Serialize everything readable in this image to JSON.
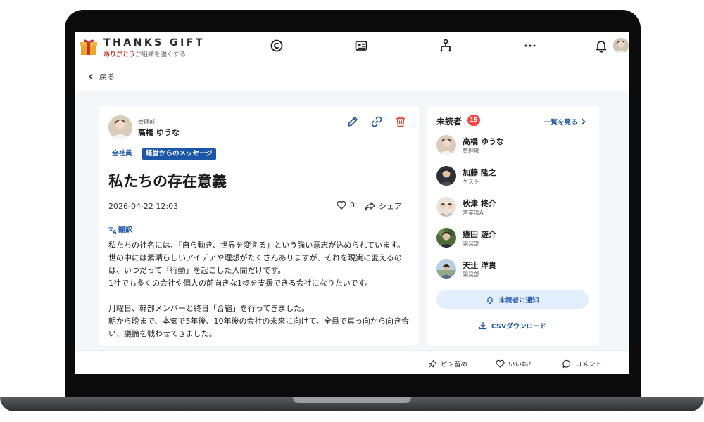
{
  "app": {
    "brand_name": "THANKS GIFT",
    "tagline_highlight": "ありがとう",
    "tagline_rest": "が組織を強くする"
  },
  "header": {
    "nav_icons": [
      "copyright-icon",
      "news-icon",
      "org-chart-icon",
      "more-icon",
      "bell-icon"
    ]
  },
  "back_label": "戻る",
  "post": {
    "department": "管理部",
    "author": "高橋 ゆうな",
    "tags": [
      "全社員",
      "経営からのメッセージ"
    ],
    "title": "私たちの存在意義",
    "datetime": "2026-04-22 12:03",
    "like_count": "0",
    "share_label": "シェア",
    "translate_label": "翻訳",
    "body": [
      "私たちの社名には、「自ら動き、世界を変える」という強い意志が込められています。",
      "世の中には素晴らしいアイデアや理想がたくさんありますが、それを現実に変えるのは、いつだって「行動」を起こした人間だけです。",
      "1社でも多くの会社や個人の前向きな1歩を支援できる会社になりたいです。",
      "月曜日、幹部メンバーと終日「合宿」を行ってきました。",
      "朝から晩まで、本気で5年後、10年後の会社の未来に向けて、全員で真っ向から向き合い、議論を戦わせてきました。"
    ]
  },
  "unread": {
    "title": "未読者",
    "count": "15",
    "see_all_label": "一覧を見る",
    "readers": [
      {
        "name": "高橋 ゆうな",
        "dept": "管理部"
      },
      {
        "name": "加藤 隆之",
        "dept": "ゲスト"
      },
      {
        "name": "秋津 柊介",
        "dept": "営業部A"
      },
      {
        "name": "幾田 遊介",
        "dept": "開発部"
      },
      {
        "name": "天辻 洋貴",
        "dept": "開発部"
      }
    ],
    "notify_label": "未読者に通知",
    "csv_label": "CSVダウンロード"
  },
  "footer": {
    "pin_label": "ピン留め",
    "like_label": "いいね！",
    "comment_label": "コメント"
  },
  "colors": {
    "accent": "#1f57a8",
    "badge": "#ef4a44",
    "tag_bg": "#1c56a7",
    "notify_bg": "#e2eefc"
  }
}
